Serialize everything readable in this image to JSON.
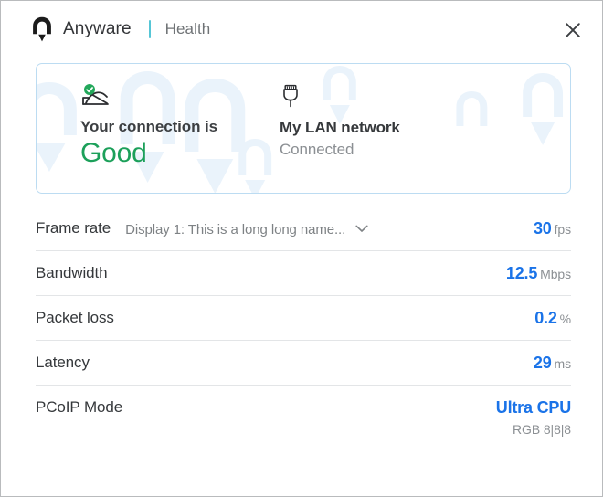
{
  "window": {
    "title_brand": "Anyware",
    "title_section": "Health",
    "close_label": "×"
  },
  "icons": {
    "logo": "anyware-logo-icon",
    "close": "close-icon",
    "connection": "connection-good-icon",
    "lan": "lan-plug-icon",
    "chevron": "chevron-down-icon"
  },
  "status_card": {
    "connection": {
      "label": "Your connection is",
      "value": "Good",
      "value_color": "#1ca05a"
    },
    "network": {
      "label": "My LAN network",
      "value": "Connected"
    }
  },
  "metrics": [
    {
      "name": "Frame rate",
      "selector": "Display 1: This is a long long name...",
      "value": "30",
      "unit": "fps",
      "subvalue": ""
    },
    {
      "name": "Bandwidth",
      "selector": "",
      "value": "12.5",
      "unit": "Mbps",
      "subvalue": ""
    },
    {
      "name": "Packet loss",
      "selector": "",
      "value": "0.2",
      "unit": "%",
      "subvalue": ""
    },
    {
      "name": "Latency",
      "selector": "",
      "value": "29",
      "unit": "ms",
      "subvalue": ""
    },
    {
      "name": "PCoIP Mode",
      "selector": "",
      "value": "Ultra CPU",
      "unit": "",
      "subvalue": "RGB 8|8|8"
    }
  ],
  "colors": {
    "accent_blue": "#1a73e8",
    "good_green": "#1ca05a",
    "card_border": "#bcdcf2",
    "brand_divider": "#56c6d6"
  }
}
